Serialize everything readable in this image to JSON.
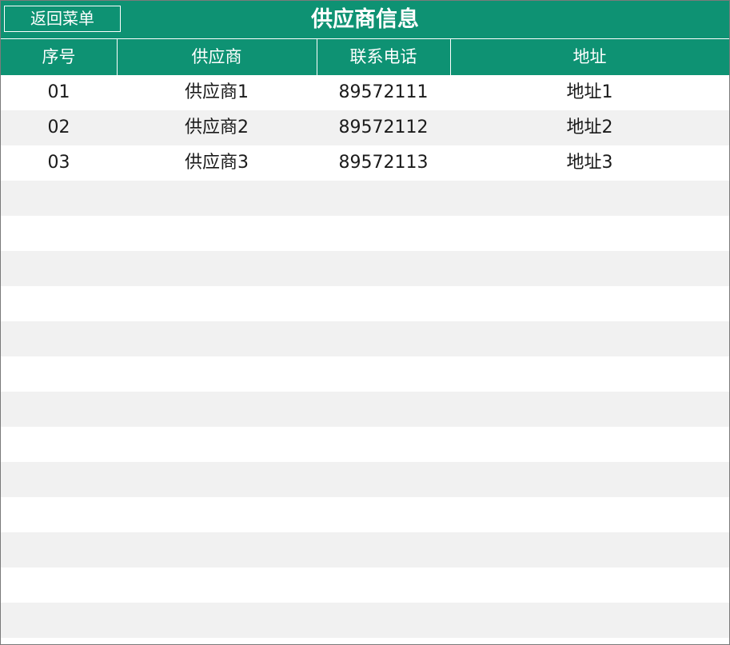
{
  "header": {
    "back_label": "返回菜单",
    "title": "供应商信息"
  },
  "table": {
    "columns": [
      "序号",
      "供应商",
      "联系电话",
      "地址"
    ],
    "rows": [
      {
        "no": "01",
        "supplier": "供应商1",
        "phone": "89572111",
        "address": "地址1"
      },
      {
        "no": "02",
        "supplier": "供应商2",
        "phone": "89572112",
        "address": "地址2"
      },
      {
        "no": "03",
        "supplier": "供应商3",
        "phone": "89572113",
        "address": "地址3"
      }
    ]
  },
  "colors": {
    "accent": "#0e9273",
    "row_alt": "#f1f1f1"
  }
}
